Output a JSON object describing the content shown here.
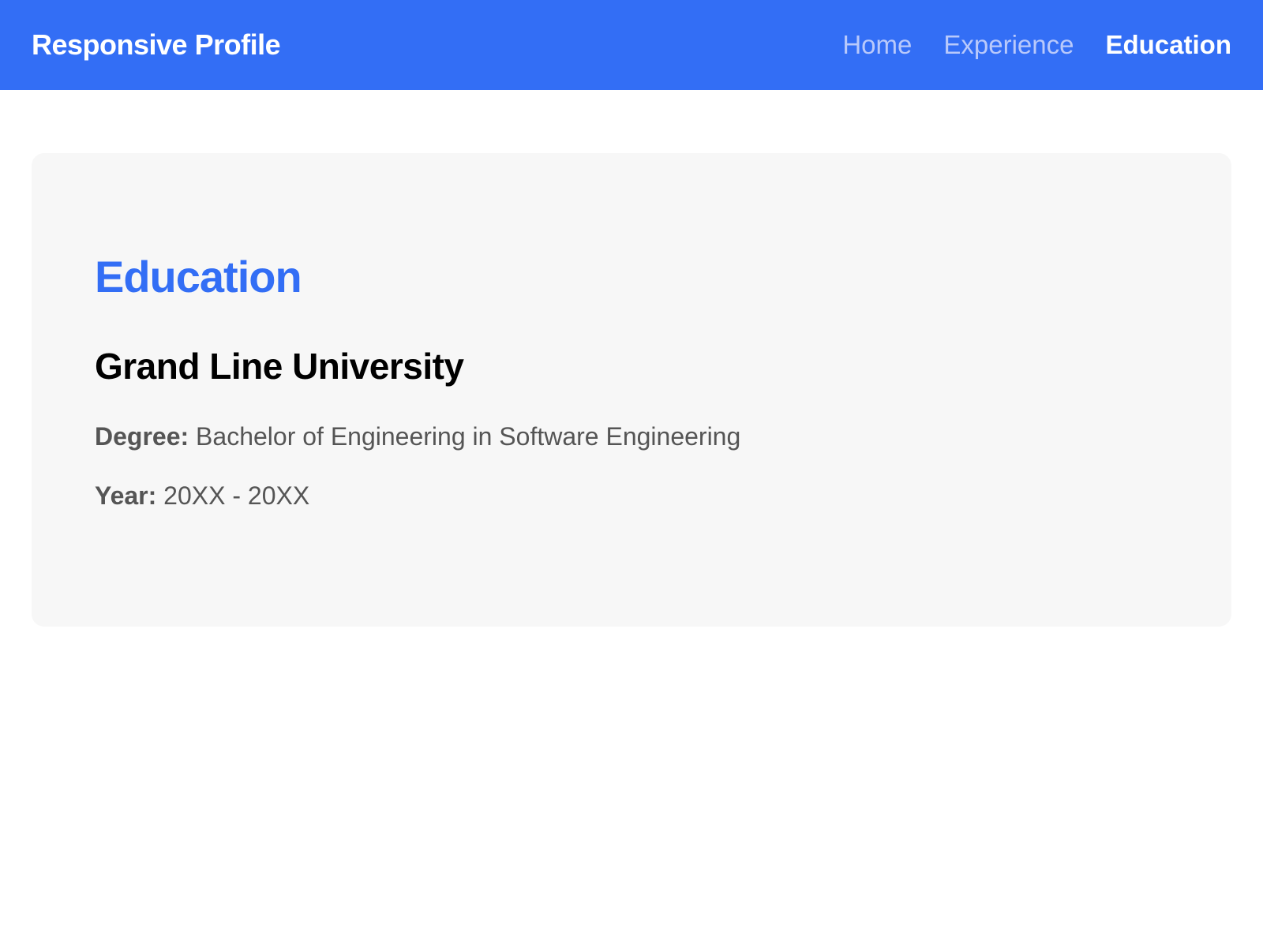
{
  "header": {
    "brand": "Responsive Profile",
    "nav": [
      {
        "label": "Home"
      },
      {
        "label": "Experience"
      },
      {
        "label": "Education",
        "active": true
      }
    ]
  },
  "section": {
    "title": "Education",
    "school": "Grand Line University",
    "degree_label": "Degree:",
    "degree": "Bachelor of Engineering in Software Engineering",
    "year_label": "Year:",
    "year": "20XX - 20XX"
  },
  "colors": {
    "accent": "#336ef5",
    "card_bg": "#f7f7f7"
  }
}
